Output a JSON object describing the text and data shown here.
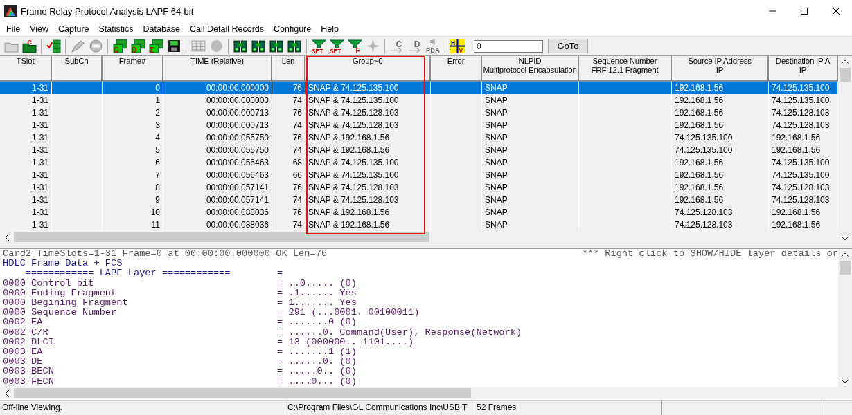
{
  "window": {
    "title": "Frame Relay Protocol Analysis LAPF 64-bit"
  },
  "menu": [
    "File",
    "View",
    "Capture",
    "Statistics",
    "Database",
    "Call Detail Records",
    "Configure",
    "Help"
  ],
  "toolbar": [
    {
      "kind": "folder",
      "disabled": true
    },
    {
      "kind": "folder-c",
      "label": "C",
      "disabled": false
    },
    {
      "kind": "separator"
    },
    {
      "kind": "checklist",
      "disabled": false
    },
    {
      "kind": "separator"
    },
    {
      "kind": "pen",
      "disabled": true
    },
    {
      "kind": "stop",
      "disabled": true
    },
    {
      "kind": "separator"
    },
    {
      "kind": "screen",
      "label": "C",
      "disabled": false
    },
    {
      "kind": "screen",
      "label": "D",
      "disabled": false
    },
    {
      "kind": "screen",
      "label": "Σ",
      "disabled": false
    },
    {
      "kind": "save",
      "disabled": false
    },
    {
      "kind": "separator"
    },
    {
      "kind": "grid",
      "disabled": true
    },
    {
      "kind": "circle",
      "disabled": true
    },
    {
      "kind": "separator"
    },
    {
      "kind": "binoculars",
      "disabled": false
    },
    {
      "kind": "binoculars",
      "disabled": false
    },
    {
      "kind": "binoculars",
      "disabled": false
    },
    {
      "kind": "binoculars",
      "disabled": false
    },
    {
      "kind": "separator"
    },
    {
      "kind": "funnel",
      "label": "SET",
      "disabled": false
    },
    {
      "kind": "funnel",
      "label": "SET",
      "disabled": false
    },
    {
      "kind": "funnel",
      "label": "F",
      "disabled": false
    },
    {
      "kind": "burst",
      "disabled": true
    },
    {
      "kind": "separator"
    },
    {
      "kind": "arrow",
      "label": "C",
      "disabled": true
    },
    {
      "kind": "arrow",
      "label": "D",
      "disabled": true
    },
    {
      "kind": "pda",
      "label": "PDA",
      "disabled": true
    },
    {
      "kind": "separator"
    },
    {
      "kind": "hv",
      "label": "H",
      "label2": "V",
      "disabled": false
    }
  ],
  "goto": {
    "value": "0",
    "button": "GoTo"
  },
  "table": {
    "columns": [
      {
        "lines": [
          "TSlot"
        ],
        "highlighted": false
      },
      {
        "lines": [
          "SubCh"
        ],
        "highlighted": false
      },
      {
        "lines": [
          "Frame#"
        ],
        "highlighted": false
      },
      {
        "lines": [
          "TIME (Relative)"
        ],
        "highlighted": false
      },
      {
        "lines": [
          "Len"
        ],
        "highlighted": false
      },
      {
        "lines": [
          "Group~0"
        ],
        "highlighted": true
      },
      {
        "lines": [
          "Error"
        ],
        "highlighted": false
      },
      {
        "lines": [
          "NLPID",
          "Multiprotocol Encapsulation"
        ],
        "highlighted": false
      },
      {
        "lines": [
          "Sequence Number",
          "FRF 12.1 Fragment"
        ],
        "highlighted": false
      },
      {
        "lines": [
          "Source IP Address",
          "IP"
        ],
        "highlighted": false
      },
      {
        "lines": [
          "Destination IP A",
          "IP"
        ],
        "highlighted": false
      }
    ],
    "rows": [
      {
        "selected": true,
        "cells": [
          "1-31",
          "",
          "0",
          "00:00:00.000000",
          "76",
          "SNAP & 74.125.135.100",
          "",
          "SNAP",
          "",
          "192.168.1.56",
          "74.125.135.100"
        ]
      },
      {
        "selected": false,
        "cells": [
          "1-31",
          "",
          "1",
          "00:00:00.000000",
          "74",
          "SNAP & 74.125.135.100",
          "",
          "SNAP",
          "",
          "192.168.1.56",
          "74.125.135.100"
        ]
      },
      {
        "selected": false,
        "cells": [
          "1-31",
          "",
          "2",
          "00:00:00.000713",
          "76",
          "SNAP & 74.125.128.103",
          "",
          "SNAP",
          "",
          "192.168.1.56",
          "74.125.128.103"
        ]
      },
      {
        "selected": false,
        "cells": [
          "1-31",
          "",
          "3",
          "00:00:00.000713",
          "74",
          "SNAP & 74.125.128.103",
          "",
          "SNAP",
          "",
          "192.168.1.56",
          "74.125.128.103"
        ]
      },
      {
        "selected": false,
        "cells": [
          "1-31",
          "",
          "4",
          "00:00:00.055750",
          "76",
          "SNAP & 192.168.1.56",
          "",
          "SNAP",
          "",
          "74.125.135.100",
          "192.168.1.56"
        ]
      },
      {
        "selected": false,
        "cells": [
          "1-31",
          "",
          "5",
          "00:00:00.055750",
          "74",
          "SNAP & 192.168.1.56",
          "",
          "SNAP",
          "",
          "74.125.135.100",
          "192.168.1.56"
        ]
      },
      {
        "selected": false,
        "cells": [
          "1-31",
          "",
          "6",
          "00:00:00.056463",
          "68",
          "SNAP & 74.125.135.100",
          "",
          "SNAP",
          "",
          "192.168.1.56",
          "74.125.135.100"
        ]
      },
      {
        "selected": false,
        "cells": [
          "1-31",
          "",
          "7",
          "00:00:00.056463",
          "66",
          "SNAP & 74.125.135.100",
          "",
          "SNAP",
          "",
          "192.168.1.56",
          "74.125.135.100"
        ]
      },
      {
        "selected": false,
        "cells": [
          "1-31",
          "",
          "8",
          "00:00:00.057141",
          "76",
          "SNAP & 74.125.128.103",
          "",
          "SNAP",
          "",
          "192.168.1.56",
          "74.125.128.103"
        ]
      },
      {
        "selected": false,
        "cells": [
          "1-31",
          "",
          "9",
          "00:00:00.057141",
          "74",
          "SNAP & 74.125.128.103",
          "",
          "SNAP",
          "",
          "192.168.1.56",
          "74.125.128.103"
        ]
      },
      {
        "selected": false,
        "cells": [
          "1-31",
          "",
          "10",
          "00:00:00.088036",
          "76",
          "SNAP & 192.168.1.56",
          "",
          "SNAP",
          "",
          "74.125.128.103",
          "192.168.1.56"
        ]
      },
      {
        "selected": false,
        "cells": [
          "1-31",
          "",
          "11",
          "00:00:00.088036",
          "74",
          "SNAP & 192.168.1.56",
          "",
          "SNAP",
          "",
          "74.125.128.103",
          "192.168.1.56"
        ]
      }
    ]
  },
  "detail": {
    "header": "Card2 TimeSlots=1-31 Frame=0 at 00:00:00.000000 OK Len=76",
    "hint": "*** Right click to SHOW/HIDE layer details or",
    "lines": [
      {
        "kind": "title",
        "text": "HDLC Frame Data + FCS"
      },
      {
        "kind": "layer",
        "name": "    ============ LAPF Layer ============",
        "value": "="
      },
      {
        "kind": "field",
        "name": "0000 Control bit",
        "value": "= ..0..... (0)"
      },
      {
        "kind": "field",
        "name": "0000 Ending Fragment",
        "value": "= .1...... Yes"
      },
      {
        "kind": "field",
        "name": "0000 Begining Fragment",
        "value": "= 1....... Yes"
      },
      {
        "kind": "field",
        "name": "0000 Sequence Number",
        "value": "= 291 (...0001. 00100011)"
      },
      {
        "kind": "field",
        "name": "0002 EA",
        "value": "= .......0 (0)"
      },
      {
        "kind": "field",
        "name": "0002 C/R",
        "value": "= ......0. Command(User), Response(Network)"
      },
      {
        "kind": "field",
        "name": "0002 DLCI",
        "value": "= 13 (000000.. 1101....)"
      },
      {
        "kind": "field",
        "name": "0003 EA",
        "value": "= .......1 (1)"
      },
      {
        "kind": "field",
        "name": "0003 DE",
        "value": "= ......0. (0)"
      },
      {
        "kind": "field",
        "name": "0003 BECN",
        "value": "= .....0.. (0)"
      },
      {
        "kind": "field",
        "name": "0003 FECN",
        "value": "= ....0... (0)"
      }
    ]
  },
  "status_bar": [
    "Off-line Viewing.",
    "C:\\Program Files\\GL Communications Inc\\USB T",
    "52 Frames"
  ]
}
